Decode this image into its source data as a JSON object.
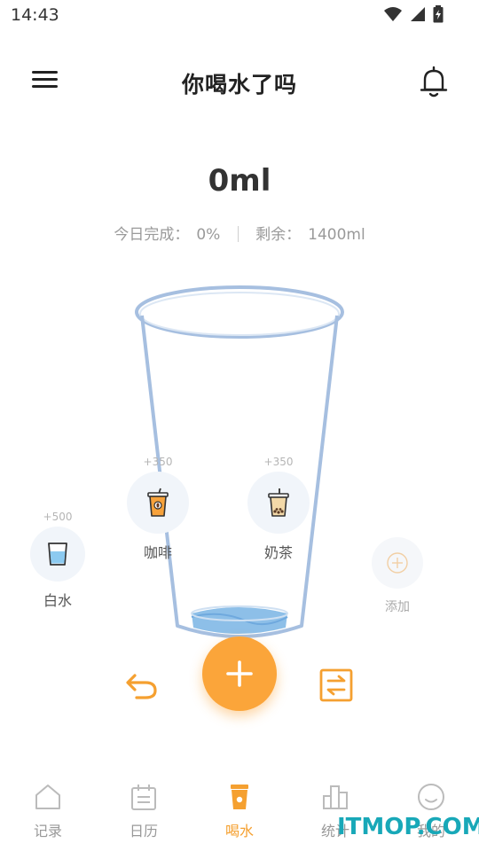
{
  "status_bar": {
    "time": "14:43"
  },
  "header": {
    "title": "你喝水了吗"
  },
  "intake": {
    "amount": "0ml",
    "completed_label": "今日完成：",
    "completed_value": "0%",
    "remaining_label": "剩余：",
    "remaining_value": "1400ml"
  },
  "drinks": [
    {
      "name": "白水",
      "amount": "+500",
      "icon": "water-cup-icon"
    },
    {
      "name": "咖啡",
      "amount": "+350",
      "icon": "coffee-icon"
    },
    {
      "name": "奶茶",
      "amount": "+350",
      "icon": "milk-tea-icon"
    },
    {
      "name": "添加",
      "icon": "add-circle-icon"
    }
  ],
  "nav": {
    "items": [
      {
        "label": "记录",
        "icon": "house-icon"
      },
      {
        "label": "日历",
        "icon": "calendar-icon"
      },
      {
        "label": "喝水",
        "icon": "cup-icon",
        "active": true
      },
      {
        "label": "统计",
        "icon": "stats-icon"
      },
      {
        "label": "我的",
        "icon": "smile-icon"
      }
    ]
  },
  "watermark": "ITMOP.COM",
  "colors": {
    "accent": "#fba53a",
    "cup_outline": "#a6bfe0",
    "water": "#8dbfe8"
  }
}
